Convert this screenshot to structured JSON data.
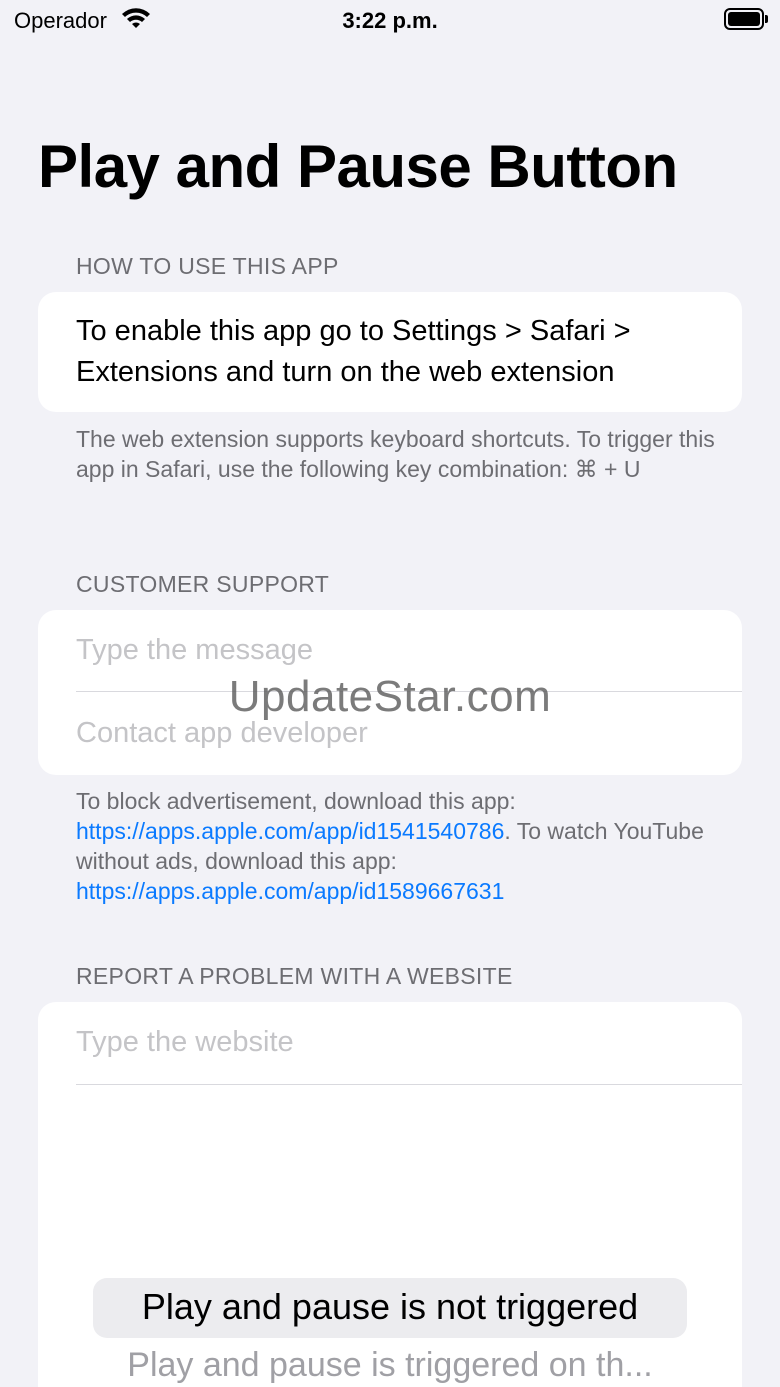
{
  "status_bar": {
    "carrier": "Operador",
    "time": "3:22 p.m.",
    "wifi_icon": "wifi-icon",
    "battery_icon": "battery-icon"
  },
  "page": {
    "title": "Play and Pause Button"
  },
  "how_to": {
    "header": "HOW TO USE THIS APP",
    "instructions": "To enable this app go to Settings > Safari > Extensions and turn on the web extension",
    "footer": "The web extension supports keyboard shortcuts. To trigger this app in Safari, use the following key combination: ⌘ + U"
  },
  "support": {
    "header": "CUSTOMER SUPPORT",
    "message_placeholder": "Type the message",
    "contact_label": "Contact app developer",
    "footer_part1": "To block advertisement, download this app: ",
    "link1": "https://apps.apple.com/app/id1541540786",
    "footer_part2": ". To watch YouTube without ads, download this app: ",
    "link2": "https://apps.apple.com/app/id1589667631"
  },
  "watermark": "UpdateStar.com",
  "report": {
    "header": "REPORT A PROBLEM WITH A WEBSITE",
    "website_placeholder": "Type the website",
    "picker_options": [
      "Play and pause is not triggered",
      "Play and pause is triggered on th..."
    ]
  },
  "colors": {
    "background": "#f2f2f7",
    "link": "#0a7aff",
    "secondary_text": "#6d6d72",
    "placeholder": "#c4c4c7"
  }
}
